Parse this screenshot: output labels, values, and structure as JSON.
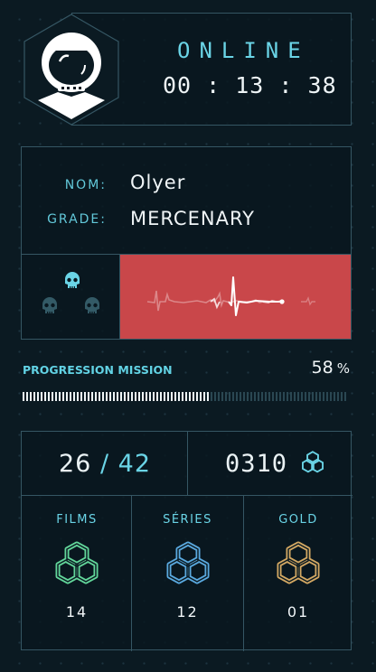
{
  "header": {
    "status": "ONLINE",
    "timer": "00 : 13 : 38",
    "avatar_icon": "astronaut-helmet-icon"
  },
  "identity": {
    "name_label": "NOM:",
    "name_value": "Olyer",
    "grade_label": "GRADE:",
    "grade_value": "MERCENARY"
  },
  "vitals": {
    "lives_total": 3,
    "lives_active": 1,
    "life_icon": "skull-icon",
    "heart_monitor_color": "#c9474a"
  },
  "progress": {
    "label": "PROGRESSION MISSION",
    "value": "58",
    "unit": "%",
    "fraction": 0.58
  },
  "stats": {
    "completed": "26",
    "separator": "/",
    "total": "42",
    "credits": "0310",
    "credits_icon": "hex-knot-icon",
    "categories": [
      {
        "title": "FILMS",
        "value": "14",
        "color": "#62d69a"
      },
      {
        "title": "SÉRIES",
        "value": "12",
        "color": "#5aa9df"
      },
      {
        "title": "GOLD",
        "value": "01",
        "color": "#d3a863"
      }
    ]
  },
  "colors": {
    "accent": "#62c8d9",
    "border": "#355663",
    "background": "#0b1a22"
  }
}
